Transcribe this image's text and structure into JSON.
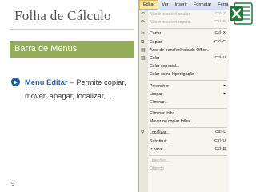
{
  "slide": {
    "title": "Folha de Cálculo",
    "section": "Barra de Menus",
    "body_highlight": "Menu Editar",
    "body_rest": " – Permite copiar, mover, apagar, localizar, …",
    "page_number": "9"
  },
  "menubar": {
    "items": [
      "Editar",
      "Ver",
      "Inserir",
      "Formatar",
      "Ferra"
    ]
  },
  "menu": {
    "items": [
      {
        "label": "Não é possível anular",
        "shortcut": "Ctrl+Z",
        "disabled": true
      },
      {
        "label": "Não é possível repetir",
        "shortcut": "Ctrl+R",
        "disabled": true
      },
      {
        "label": "Cortar",
        "shortcut": "Ctrl+X",
        "disabled": false
      },
      {
        "label": "Copiar",
        "shortcut": "Ctrl+C",
        "disabled": false
      },
      {
        "label": "Área de transferência do Office...",
        "shortcut": "",
        "disabled": false
      },
      {
        "label": "Colar",
        "shortcut": "Ctrl+V",
        "disabled": false
      },
      {
        "label": "Colar especial...",
        "shortcut": "",
        "disabled": false
      },
      {
        "label": "Colar como hiperligação",
        "shortcut": "",
        "disabled": false
      },
      {
        "label": "Preencher",
        "shortcut": "",
        "disabled": false
      },
      {
        "label": "Limpar",
        "shortcut": "",
        "disabled": false
      },
      {
        "label": "Eliminar...",
        "shortcut": "",
        "disabled": false
      },
      {
        "label": "Eliminar folha",
        "shortcut": "",
        "disabled": false
      },
      {
        "label": "Mover ou copiar folha...",
        "shortcut": "",
        "disabled": false
      },
      {
        "label": "Localizar...",
        "shortcut": "Ctrl+L",
        "disabled": false
      },
      {
        "label": "Substituir...",
        "shortcut": "Ctrl+U",
        "disabled": false
      },
      {
        "label": "Ir para...",
        "shortcut": "Ctrl+B",
        "disabled": false
      },
      {
        "label": "Ligações...",
        "shortcut": "",
        "disabled": true
      },
      {
        "label": "Objecto",
        "shortcut": "",
        "disabled": true
      }
    ]
  },
  "colors": {
    "section_bar": "#93ad58",
    "bullet": "#1f5fa8",
    "excel_green": "#1e7a3c"
  }
}
